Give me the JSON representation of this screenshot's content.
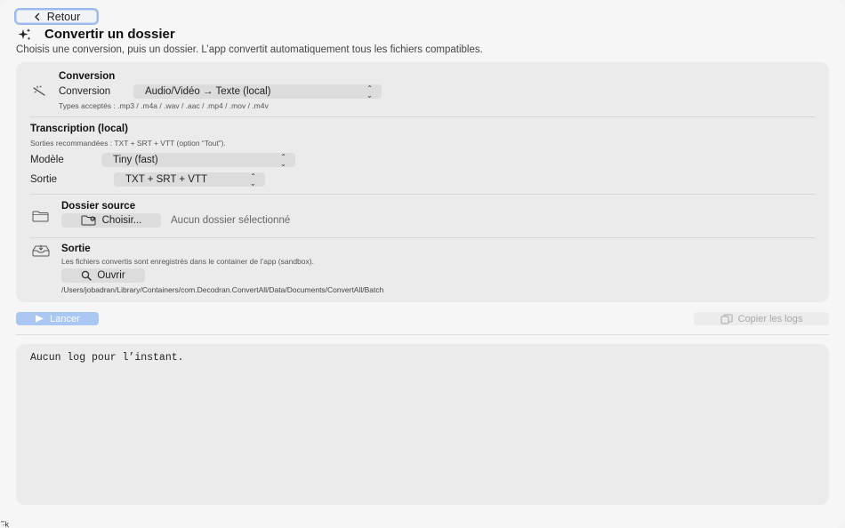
{
  "header": {
    "back_label": "Retour",
    "title": "Convertir un dossier",
    "subtitle": "Choisis une conversion, puis un dossier. L’app convertit automatiquement tous les fichiers compatibles."
  },
  "conversion": {
    "section_title": "Conversion",
    "label": "Conversion",
    "selected": "Audio/Vidéo → Texte (local)",
    "accepted_types": "Types acceptés : .mp3 / .m4a / .wav / .aac / .mp4 / .mov / .m4v"
  },
  "transcription": {
    "section_title": "Transcription (local)",
    "hint": "Sorties recommandées : TXT + SRT + VTT (option “Tout”).",
    "model_label": "Modèle",
    "model_selected": "Tiny (fast)",
    "output_label": "Sortie",
    "output_selected": "TXT + SRT + VTT"
  },
  "source": {
    "section_title": "Dossier source",
    "choose_label": "Choisir...",
    "status": "Aucun dossier sélectionné"
  },
  "output": {
    "section_title": "Sortie",
    "description": "Les fichiers convertis sont enregistrés dans le container de l’app (sandbox).",
    "open_label": "Ouvrir",
    "path": "/Users/jobadran/Library/Containers/com.Decodran.ConvertAll/Data/Documents/ConvertAll/Batch"
  },
  "actions": {
    "run_label": "Lancer",
    "copy_logs_label": "Copier les logs"
  },
  "logs": {
    "text": "Aucun log pour l’instant."
  },
  "footer": {
    "corner_text": "Fk"
  },
  "colors": {
    "accent": "#9ab9ee",
    "run_button": "#a9c7f2",
    "card_bg": "#ebebeb"
  }
}
